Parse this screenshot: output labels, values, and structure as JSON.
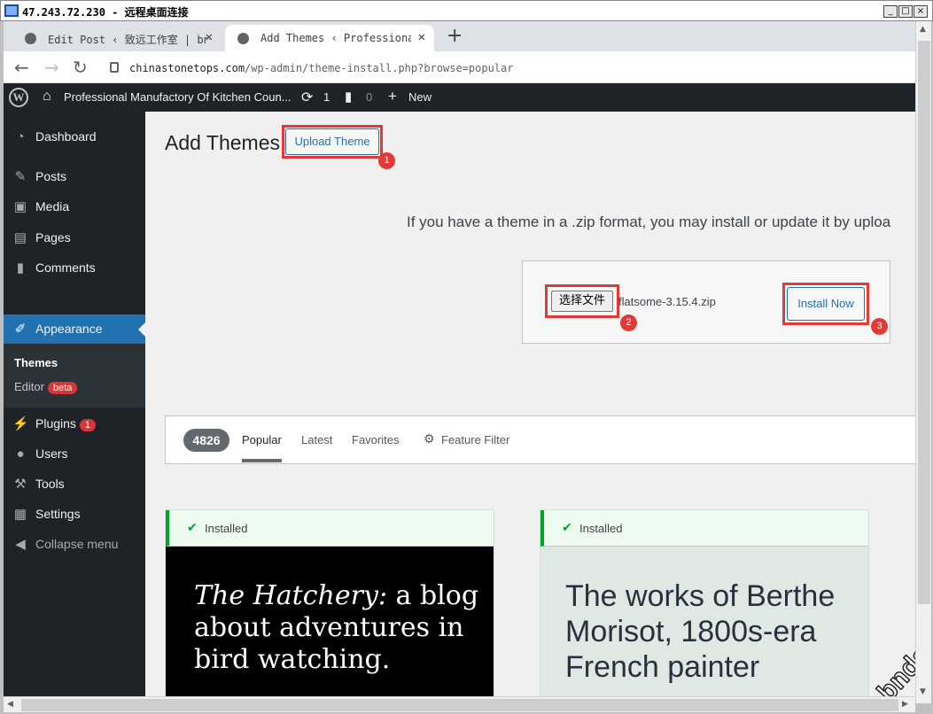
{
  "window": {
    "title": "47.243.72.230 - 远程桌面连接",
    "minimize": "_",
    "restore": "□",
    "close": "×"
  },
  "browser": {
    "tabs": [
      {
        "label": "Edit Post ‹ 致远工作室 | bnds",
        "icon": "globe-icon"
      },
      {
        "label": "Add Themes ‹ Professional Manufactory",
        "icon": "globe-icon"
      }
    ],
    "new_tab": "+",
    "url_host": "chinastonetops.com",
    "url_path": "/wp-admin/theme-install.php?browse=popular"
  },
  "adminbar": {
    "site_name": "Professional Manufactory Of Kitchen Coun...",
    "updates_count": "1",
    "comments_count": "0",
    "new_label": "New"
  },
  "sidebar": {
    "items": [
      {
        "label": "Dashboard",
        "icon": "dashboard-icon"
      },
      {
        "label": "Posts",
        "icon": "pin-icon"
      },
      {
        "label": "Media",
        "icon": "media-icon"
      },
      {
        "label": "Pages",
        "icon": "pages-icon"
      },
      {
        "label": "Comments",
        "icon": "comment-icon"
      },
      {
        "label": "Appearance",
        "icon": "paintbrush-icon"
      },
      {
        "label": "Plugins",
        "icon": "plugin-icon",
        "badge": "1"
      },
      {
        "label": "Users",
        "icon": "users-icon"
      },
      {
        "label": "Tools",
        "icon": "wrench-icon"
      },
      {
        "label": "Settings",
        "icon": "settings-icon"
      },
      {
        "label": "Collapse menu",
        "icon": "collapse-icon"
      }
    ],
    "submenu": {
      "themes": "Themes",
      "editor": "Editor",
      "editor_badge": "beta"
    }
  },
  "main": {
    "page_title": "Add Themes",
    "upload_button": "Upload Theme",
    "upload_help": "If you have a theme in a .zip format, you may install or update it by uploa",
    "choose_file": "选择文件",
    "file_name": "flatsome-3.15.4.zip",
    "install_button": "Install Now",
    "annotations": [
      "1",
      "2",
      "3"
    ],
    "filter": {
      "count": "4826",
      "tabs": [
        "Popular",
        "Latest",
        "Favorites"
      ],
      "feature_filter": "Feature Filter"
    },
    "cards": [
      {
        "installed": "Installed",
        "screenshot_text_italic": "The Hatchery:",
        "screenshot_text": " a blog about adventures in bird watching."
      },
      {
        "installed": "Installed",
        "screenshot_text": "The works of Berthe Morisot, 1800s-era French painter"
      }
    ],
    "watermark": "bndstone.com"
  },
  "colors": {
    "admin_dark": "#1d2327",
    "wp_blue": "#2271b1",
    "highlight_red": "#e53935",
    "installed_green": "#00a32a"
  }
}
